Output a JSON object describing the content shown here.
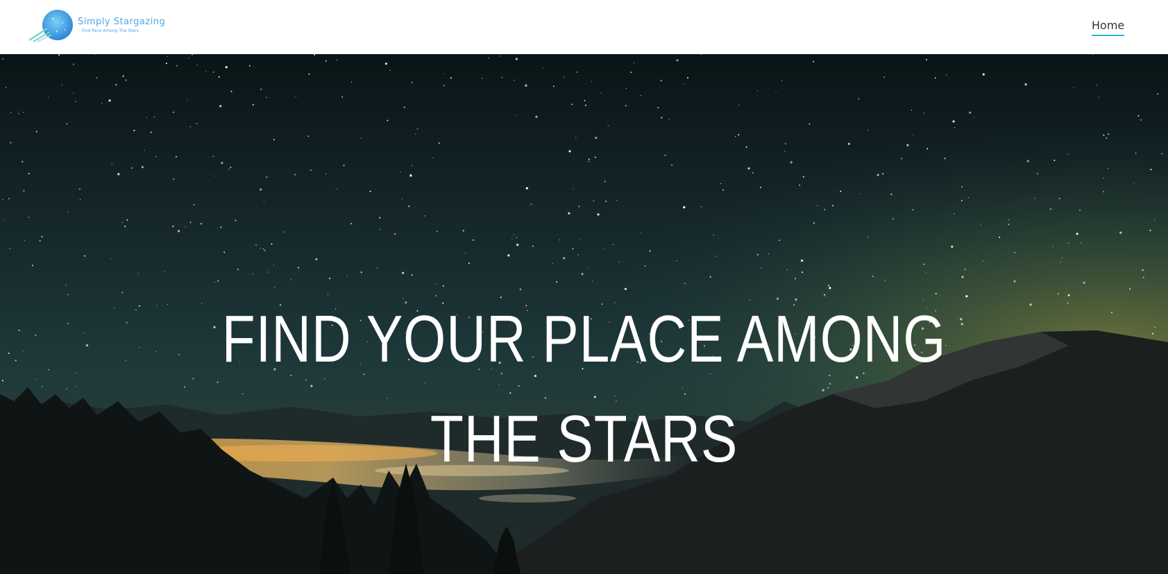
{
  "header": {
    "logo": {
      "title": "Simply Stargazing",
      "tagline": "Find Pece Among The Stars"
    },
    "nav": {
      "home_label": "Home"
    }
  },
  "hero": {
    "title_line1": "FIND YOUR PLACE AMONG",
    "title_line2": "THE STARS"
  },
  "colors": {
    "accent": "#2bb3d6",
    "logo_blue": "#4ba7e3",
    "sky_dark": "#0d1a1f",
    "sky_teal": "#1f3a3c",
    "horizon_glow": "#6b7a3a",
    "city_lights": "#f0b050"
  }
}
